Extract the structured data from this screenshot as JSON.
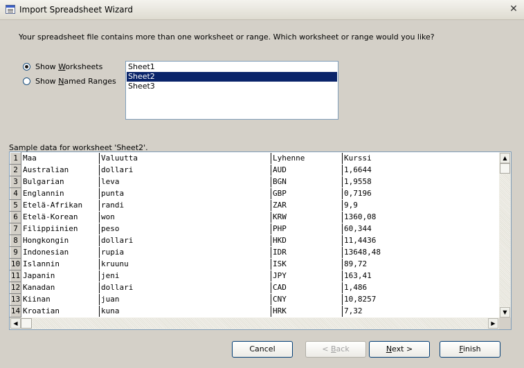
{
  "window": {
    "title": "Import Spreadsheet Wizard",
    "close_glyph": "✕"
  },
  "prompt": "Your spreadsheet file contains more than one worksheet or range. Which worksheet or range would you like?",
  "options": {
    "worksheets": {
      "pre": "Show ",
      "accel": "W",
      "post": "orksheets",
      "checked": true
    },
    "ranges": {
      "pre": "Show ",
      "accel": "N",
      "post": "amed Ranges",
      "checked": false
    }
  },
  "sheets": [
    "Sheet1",
    "Sheet2",
    "Sheet3"
  ],
  "selected_sheet": "Sheet2",
  "sample_label": "Sample data for worksheet 'Sheet2'.",
  "rows": [
    {
      "n": "1",
      "c": [
        "Maa",
        "Valuutta",
        "Lyhenne",
        "Kurssi"
      ]
    },
    {
      "n": "2",
      "c": [
        "Australian",
        "dollari",
        "AUD",
        "1,6644"
      ]
    },
    {
      "n": "3",
      "c": [
        "Bulgarian",
        "leva",
        "BGN",
        "1,9558"
      ]
    },
    {
      "n": "4",
      "c": [
        "Englannin",
        "punta",
        "GBP",
        "0,7196"
      ]
    },
    {
      "n": "5",
      "c": [
        "Etelä-Afrikan",
        "randi",
        "ZAR",
        "9,9"
      ]
    },
    {
      "n": "6",
      "c": [
        "Etelä-Korean",
        "won",
        "KRW",
        "1360,08"
      ]
    },
    {
      "n": "7",
      "c": [
        "Filippiinien",
        "peso",
        "PHP",
        "60,344"
      ]
    },
    {
      "n": "8",
      "c": [
        "Hongkongin",
        "dollari",
        "HKD",
        "11,4436"
      ]
    },
    {
      "n": "9",
      "c": [
        "Indonesian",
        "rupia",
        "IDR",
        "13648,48"
      ]
    },
    {
      "n": "10",
      "c": [
        "Islannin",
        "kruunu",
        "ISK",
        "89,72"
      ]
    },
    {
      "n": "11",
      "c": [
        "Japanin",
        "jeni",
        "JPY",
        "163,41"
      ]
    },
    {
      "n": "12",
      "c": [
        "Kanadan",
        "dollari",
        "CAD",
        "1,486"
      ]
    },
    {
      "n": "13",
      "c": [
        "Kiinan",
        "juan",
        "CNY",
        "10,8257"
      ]
    },
    {
      "n": "14",
      "c": [
        "Kroatian",
        "kuna",
        "HRK",
        "7,32"
      ]
    }
  ],
  "scroll": {
    "up": "▲",
    "down": "▼",
    "left": "◀",
    "right": "▶"
  },
  "buttons": {
    "cancel": {
      "label": "Cancel",
      "enabled": true
    },
    "back": {
      "pre": "< ",
      "accel": "B",
      "post": "ack",
      "enabled": false
    },
    "next": {
      "accel": "N",
      "post": "ext >",
      "enabled": true
    },
    "finish": {
      "accel": "F",
      "post": "inish",
      "enabled": true
    }
  }
}
